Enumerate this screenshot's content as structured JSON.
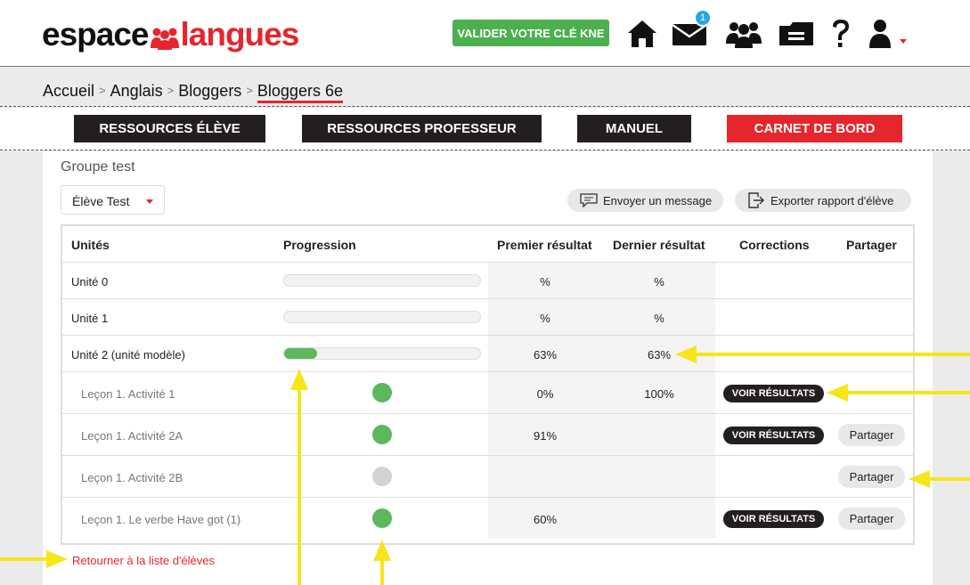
{
  "header": {
    "logo_part1": "espace",
    "logo_part2": "langues",
    "kne_button": "VALIDER VOTRE CLÉ KNE",
    "mail_badge": "1",
    "icons": [
      "home-icon",
      "mail-icon",
      "group-icon",
      "folder-icon",
      "help-icon",
      "user-icon"
    ]
  },
  "breadcrumb": {
    "items": [
      "Accueil",
      "Anglais",
      "Bloggers",
      "Bloggers 6e"
    ],
    "separator": ">"
  },
  "nav": {
    "buttons": [
      "RESSOURCES ÉLÈVE",
      "RESSOURCES PROFESSEUR",
      "MANUEL",
      "CARNET DE BORD"
    ]
  },
  "panel": {
    "group_title": "Groupe test",
    "student_select": "Élève Test",
    "send_message": "Envoyer un message",
    "export_report": "Exporter rapport d'élève"
  },
  "table": {
    "headers": [
      "Unités",
      "Progression",
      "Premier résultat",
      "Dernier résultat",
      "Corrections",
      "Partager"
    ],
    "rows": [
      {
        "label": "Unité 0",
        "type": "unit",
        "progress": 0,
        "first": "%",
        "last": "%"
      },
      {
        "label": "Unité 1",
        "type": "unit",
        "progress": 0,
        "first": "%",
        "last": "%"
      },
      {
        "label": "Unité 2 (unité modèle)",
        "type": "unit",
        "progress": 0.17,
        "first": "63%",
        "last": "63%"
      },
      {
        "label": "Leçon 1. Activité 1",
        "type": "lesson",
        "status": "done",
        "first": "0%",
        "last": "100%",
        "results_button": "VOIR RÉSULTATS",
        "share_button": ""
      },
      {
        "label": "Leçon 1. Activité 2A",
        "type": "lesson",
        "status": "done",
        "first": "91%",
        "last": "",
        "results_button": "VOIR RÉSULTATS",
        "share_button": "Partager"
      },
      {
        "label": "Leçon 1. Activité 2B",
        "type": "lesson",
        "status": "pending",
        "first": "",
        "last": "",
        "results_button": "",
        "share_button": "Partager"
      },
      {
        "label": "Leçon 1. Le verbe Have got (1)",
        "type": "lesson",
        "status": "done",
        "first": "60%",
        "last": "",
        "results_button": "VOIR RÉSULTATS",
        "share_button": "Partager"
      }
    ]
  },
  "back_link": "Retourner à la liste d'élèves",
  "colors": {
    "brand_red": "#e5262c",
    "green": "#4caf50",
    "dark": "#231f20",
    "dot_done": "#5cb85c",
    "dot_pending": "#d3d3d3",
    "annotation": "#f7e51c"
  }
}
